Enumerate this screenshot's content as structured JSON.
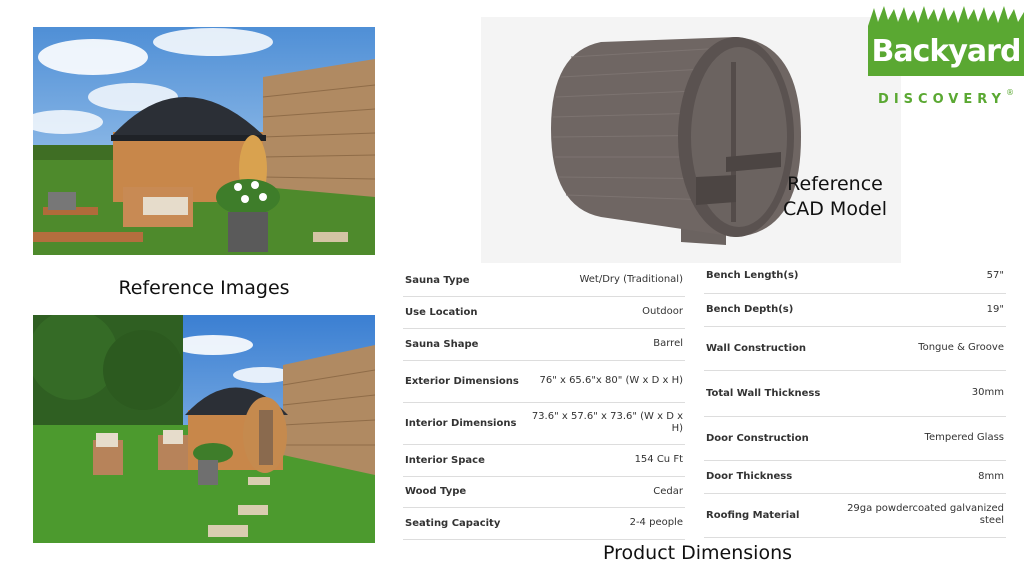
{
  "captions": {
    "reference_images": "Reference Images",
    "cad_line1": "Reference",
    "cad_line2": "CAD Model",
    "product_dimensions": "Product Dimensions"
  },
  "logo": {
    "name": "Backyard",
    "sub": "DISCOVERY",
    "registered": "®",
    "brand_green": "#5aa832"
  },
  "specs_left": [
    {
      "label": "Sauna Type",
      "value": "Wet/Dry (Traditional)"
    },
    {
      "label": "Use Location",
      "value": "Outdoor"
    },
    {
      "label": "Sauna Shape",
      "value": "Barrel"
    },
    {
      "label": "Exterior Dimensions",
      "value": "76\" x 65.6\"x 80\" (W x D x H)"
    },
    {
      "label": "Interior Dimensions",
      "value": "73.6\" x 57.6\" x 73.6\" (W x D x H)"
    },
    {
      "label": "Interior Space",
      "value": "154 Cu Ft"
    },
    {
      "label": "Wood Type",
      "value": "Cedar"
    },
    {
      "label": "Seating Capacity",
      "value": "2-4 people"
    }
  ],
  "specs_right": [
    {
      "label": "Bench Length(s)",
      "value": "57\""
    },
    {
      "label": "Bench Depth(s)",
      "value": "19\""
    },
    {
      "label": "Wall Construction",
      "value": "Tongue & Groove"
    },
    {
      "label": "Total Wall Thickness",
      "value": "30mm"
    },
    {
      "label": "Door Construction",
      "value": "Tempered Glass"
    },
    {
      "label": "Door Thickness",
      "value": "8mm"
    },
    {
      "label": "Roofing Material",
      "value": "29ga powdercoated galvanized steel"
    }
  ]
}
